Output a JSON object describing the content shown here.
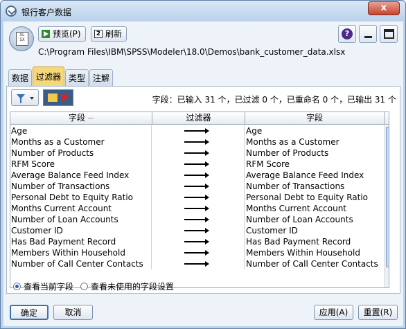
{
  "window": {
    "title": "银行客户数据",
    "close_label": "x"
  },
  "toolbar": {
    "preview_label": "预览(P)",
    "refresh_label": "刷新",
    "help_label": "?"
  },
  "node": {
    "icon_text": "XL\nSX"
  },
  "file_path": "C:\\Program Files\\IBM\\SPSS\\Modeler\\18.0\\Demos\\bank_customer_data.xlsx",
  "tabs": [
    {
      "label": "数据",
      "active": false
    },
    {
      "label": "过滤器",
      "active": true
    },
    {
      "label": "类型",
      "active": false
    },
    {
      "label": "注解",
      "active": false
    }
  ],
  "summary": "字段：已输入 31 个，已过滤 0 个，已重命名 0 个，已输出 31 个",
  "table": {
    "headers": [
      "字段",
      "过滤器",
      "字段"
    ],
    "rows": [
      {
        "in": "Age",
        "out": "Age"
      },
      {
        "in": "Months as a Customer",
        "out": "Months as a Customer"
      },
      {
        "in": "Number of Products",
        "out": "Number of Products"
      },
      {
        "in": "RFM Score",
        "out": "RFM Score"
      },
      {
        "in": "Average Balance Feed Index",
        "out": "Average Balance Feed Index"
      },
      {
        "in": "Number of Transactions",
        "out": "Number of Transactions"
      },
      {
        "in": "Personal Debt to Equity Ratio",
        "out": "Personal Debt to Equity Ratio"
      },
      {
        "in": "Months Current Account",
        "out": "Months Current Account"
      },
      {
        "in": "Number of Loan Accounts",
        "out": "Number of Loan Accounts"
      },
      {
        "in": "Customer ID",
        "out": "Customer ID"
      },
      {
        "in": "Has Bad Payment Record",
        "out": "Has Bad Payment Record"
      },
      {
        "in": "Members Within Household",
        "out": "Members Within Household"
      },
      {
        "in": "Number of Call Center Contacts",
        "out": "Number of Call Center Contacts"
      }
    ]
  },
  "radios": [
    {
      "label": "查看当前字段",
      "checked": true
    },
    {
      "label": "查看未使用的字段设置",
      "checked": false
    }
  ],
  "buttons": {
    "ok": "确定",
    "cancel": "取消",
    "apply": "应用(A)",
    "reset": "重置(R)"
  }
}
